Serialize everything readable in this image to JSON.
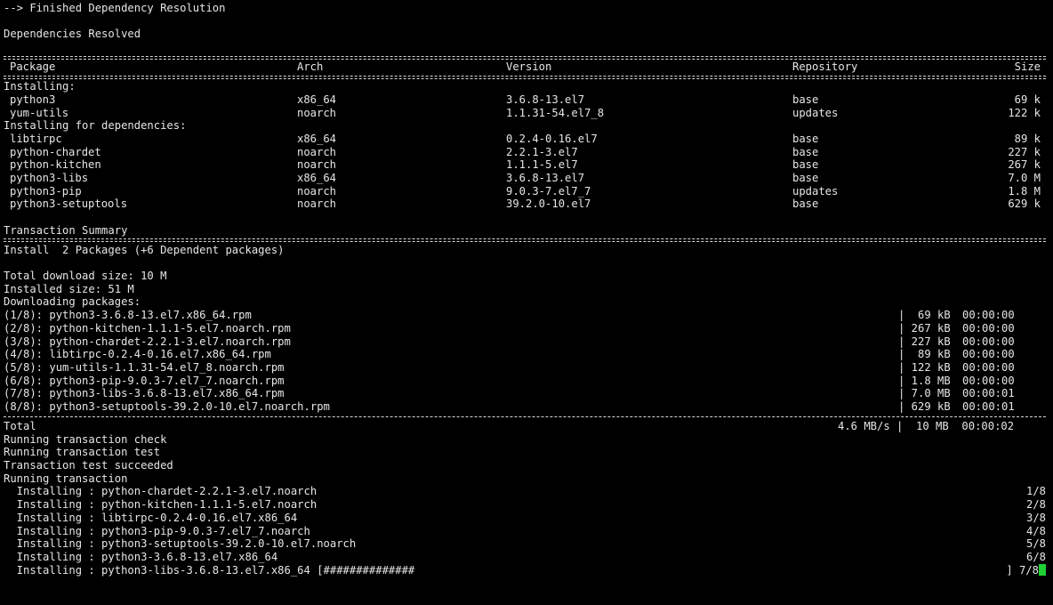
{
  "top": {
    "finished": "--> Finished Dependency Resolution",
    "resolved": "Dependencies Resolved"
  },
  "table": {
    "headers": {
      "package": "Package",
      "arch": "Arch",
      "version": "Version",
      "repository": "Repository",
      "size": "Size"
    },
    "installing_label": "Installing:",
    "installing": [
      {
        "package": "python3",
        "arch": "x86_64",
        "version": "3.6.8-13.el7",
        "repo": "base",
        "size": "69 k"
      },
      {
        "package": "yum-utils",
        "arch": "noarch",
        "version": "1.1.31-54.el7_8",
        "repo": "updates",
        "size": "122 k"
      }
    ],
    "deps_label": "Installing for dependencies:",
    "deps": [
      {
        "package": "libtirpc",
        "arch": "x86_64",
        "version": "0.2.4-0.16.el7",
        "repo": "base",
        "size": "89 k"
      },
      {
        "package": "python-chardet",
        "arch": "noarch",
        "version": "2.2.1-3.el7",
        "repo": "base",
        "size": "227 k"
      },
      {
        "package": "python-kitchen",
        "arch": "noarch",
        "version": "1.1.1-5.el7",
        "repo": "base",
        "size": "267 k"
      },
      {
        "package": "python3-libs",
        "arch": "x86_64",
        "version": "3.6.8-13.el7",
        "repo": "base",
        "size": "7.0 M"
      },
      {
        "package": "python3-pip",
        "arch": "noarch",
        "version": "9.0.3-7.el7_7",
        "repo": "updates",
        "size": "1.8 M"
      },
      {
        "package": "python3-setuptools",
        "arch": "noarch",
        "version": "39.2.0-10.el7",
        "repo": "base",
        "size": "629 k"
      }
    ]
  },
  "summary": {
    "title": "Transaction Summary",
    "install": "Install  2 Packages (+6 Dependent packages)",
    "total_download": "Total download size: 10 M",
    "installed_size": "Installed size: 51 M",
    "downloading": "Downloading packages:"
  },
  "downloads": [
    {
      "name": "(1/8): python3-3.6.8-13.el7.x86_64.rpm",
      "size": "|  69 kB",
      "time": "00:00:00"
    },
    {
      "name": "(2/8): python-kitchen-1.1.1-5.el7.noarch.rpm",
      "size": "| 267 kB",
      "time": "00:00:00"
    },
    {
      "name": "(3/8): python-chardet-2.2.1-3.el7.noarch.rpm",
      "size": "| 227 kB",
      "time": "00:00:00"
    },
    {
      "name": "(4/8): libtirpc-0.2.4-0.16.el7.x86_64.rpm",
      "size": "|  89 kB",
      "time": "00:00:00"
    },
    {
      "name": "(5/8): yum-utils-1.1.31-54.el7_8.noarch.rpm",
      "size": "| 122 kB",
      "time": "00:00:00"
    },
    {
      "name": "(6/8): python3-pip-9.0.3-7.el7_7.noarch.rpm",
      "size": "| 1.8 MB",
      "time": "00:00:00"
    },
    {
      "name": "(7/8): python3-libs-3.6.8-13.el7.x86_64.rpm",
      "size": "| 7.0 MB",
      "time": "00:00:01"
    },
    {
      "name": "(8/8): python3-setuptools-39.2.0-10.el7.noarch.rpm",
      "size": "| 629 kB",
      "time": "00:00:01"
    }
  ],
  "total": {
    "label": "Total",
    "rate": "4.6 MB/s |  10 MB  00:00:02"
  },
  "transaction": {
    "check": "Running transaction check",
    "test": "Running transaction test",
    "succeeded": "Transaction test succeeded",
    "running": "Running transaction"
  },
  "installs": [
    {
      "text": "  Installing : python-chardet-2.2.1-3.el7.noarch",
      "count": "1/8"
    },
    {
      "text": "  Installing : python-kitchen-1.1.1-5.el7.noarch",
      "count": "2/8"
    },
    {
      "text": "  Installing : libtirpc-0.2.4-0.16.el7.x86_64",
      "count": "3/8"
    },
    {
      "text": "  Installing : python3-pip-9.0.3-7.el7_7.noarch",
      "count": "4/8"
    },
    {
      "text": "  Installing : python3-setuptools-39.2.0-10.el7.noarch",
      "count": "5/8"
    },
    {
      "text": "  Installing : python3-3.6.8-13.el7.x86_64",
      "count": "6/8"
    }
  ],
  "last_install": {
    "text": "  Installing : python3-libs-3.6.8-13.el7.x86_64 [##############",
    "count": "] 7/8"
  },
  "colors": {
    "background": "#000000",
    "text": "#e6e6e6",
    "cursor": "#1fd133"
  }
}
